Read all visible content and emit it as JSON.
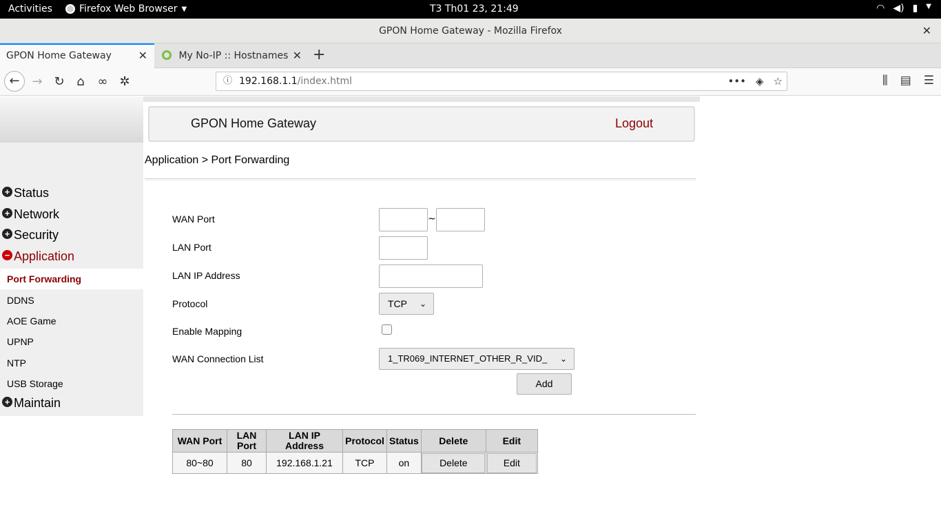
{
  "system_bar": {
    "activities": "Activities",
    "app_menu": "Firefox Web Browser",
    "clock": "T3 Th01 23, 21:49"
  },
  "window": {
    "title": "GPON Home Gateway - Mozilla Firefox"
  },
  "tabs": [
    {
      "label": "GPON Home Gateway",
      "active": true
    },
    {
      "label": "My No-IP :: Hostnames",
      "active": false
    }
  ],
  "urlbar": {
    "host": "192.168.1.1",
    "path": "/index.html"
  },
  "header": {
    "title": "GPON Home Gateway",
    "logout": "Logout"
  },
  "sidebar": {
    "groups": [
      {
        "label": "Status",
        "expanded": false
      },
      {
        "label": "Network",
        "expanded": false
      },
      {
        "label": "Security",
        "expanded": false
      },
      {
        "label": "Application",
        "expanded": true
      },
      {
        "label": "Maintain",
        "expanded": false
      }
    ],
    "application_items": [
      "Port Forwarding",
      "DDNS",
      "AOE Game",
      "UPNP",
      "NTP",
      "USB Storage"
    ],
    "selected": "Port Forwarding"
  },
  "breadcrumb": "Application > Port Forwarding",
  "form": {
    "wan_port_label": "WAN Port",
    "wan_port_start": "",
    "wan_port_end": "",
    "separator": "~",
    "lan_port_label": "LAN Port",
    "lan_port_value": "",
    "lan_ip_label": "LAN IP Address",
    "lan_ip_value": "",
    "protocol_label": "Protocol",
    "protocol_value": "TCP",
    "enable_mapping_label": "Enable Mapping",
    "enable_mapping_checked": false,
    "wan_connection_label": "WAN Connection List",
    "wan_connection_value": "1_TR069_INTERNET_OTHER_R_VID_",
    "add_button": "Add"
  },
  "table": {
    "headers": [
      "WAN Port",
      "LAN Port",
      "LAN IP Address",
      "Protocol",
      "Status",
      "Delete",
      "Edit"
    ],
    "rows": [
      {
        "wan_port": "80~80",
        "lan_port": "80",
        "lan_ip": "192.168.1.21",
        "protocol": "TCP",
        "status": "on",
        "delete": "Delete",
        "edit": "Edit"
      }
    ]
  }
}
